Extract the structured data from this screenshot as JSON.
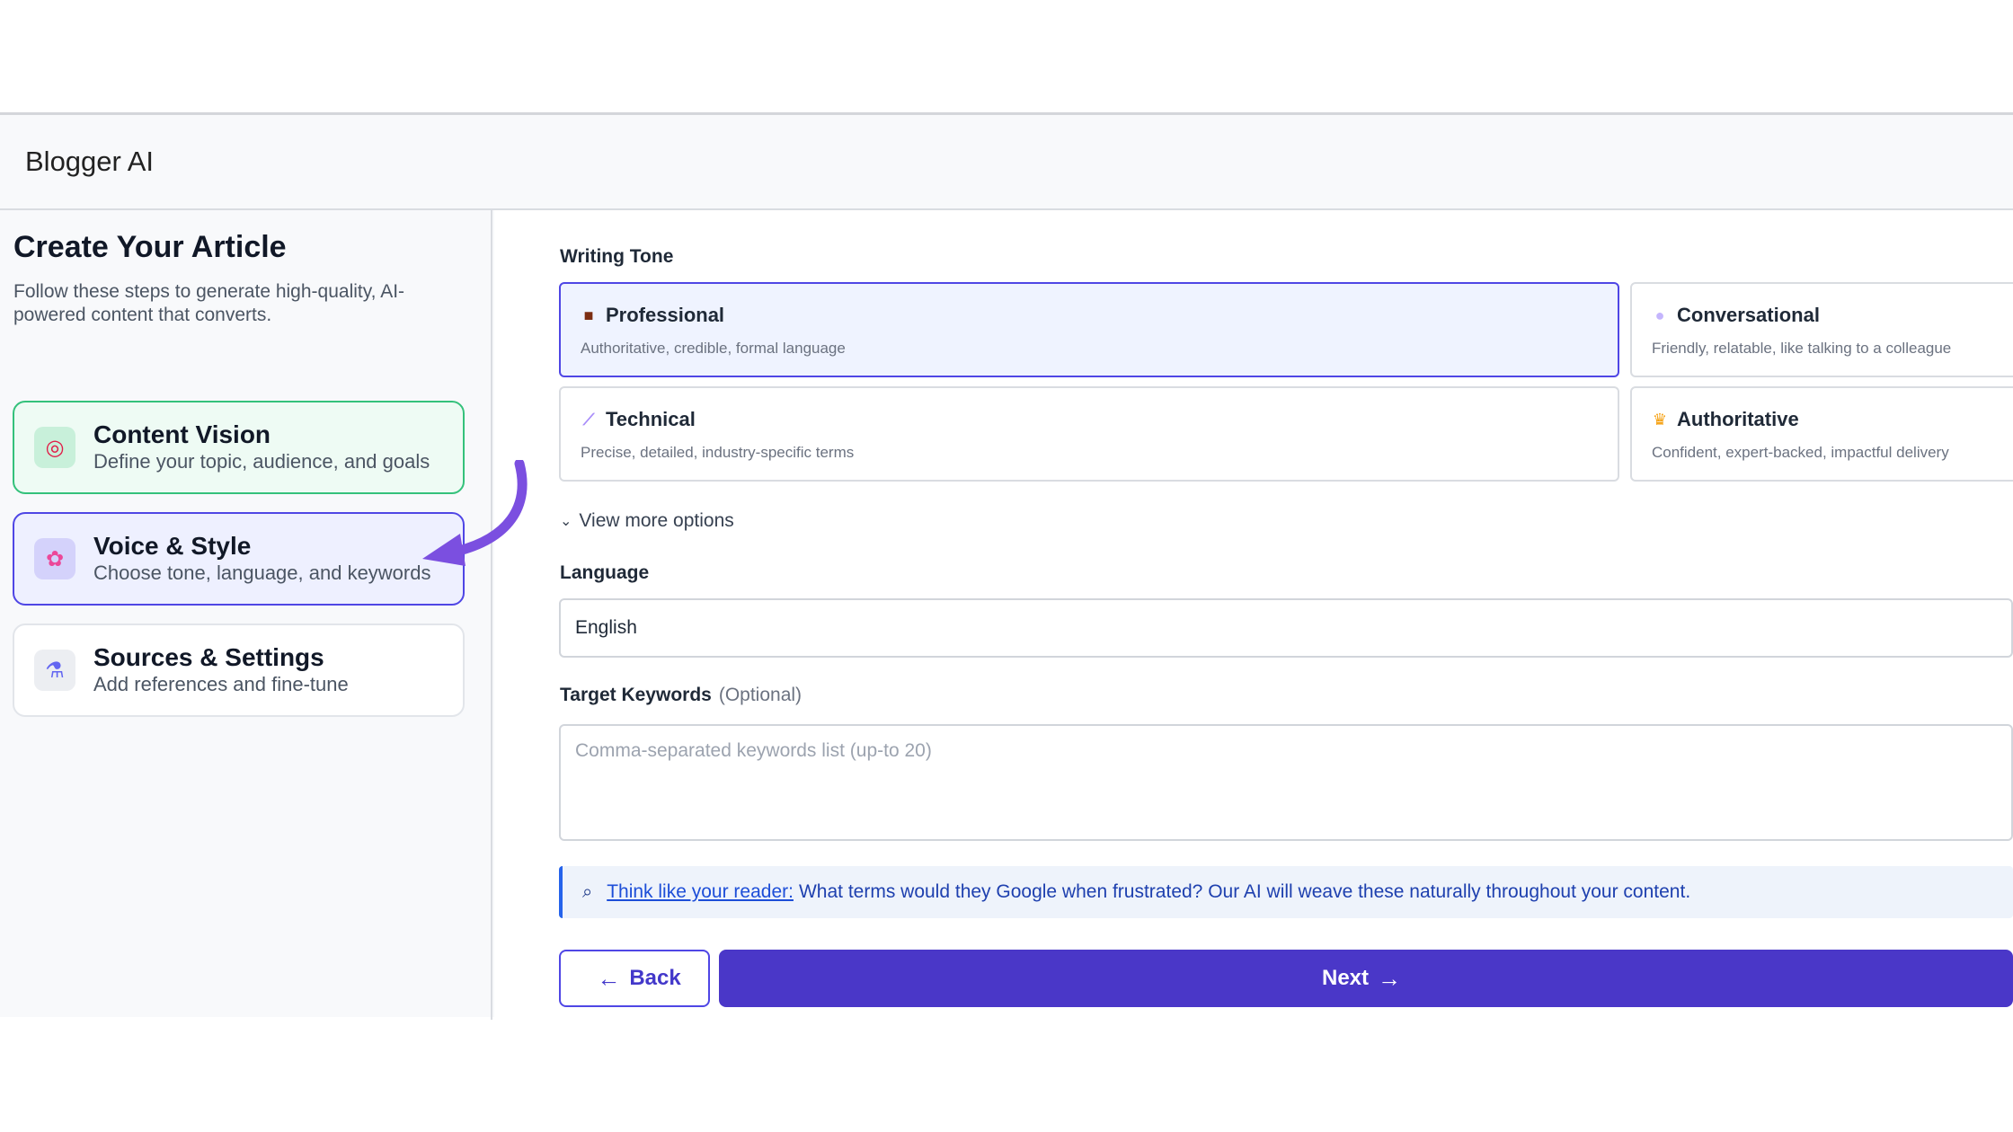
{
  "app": {
    "title": "Blogger AI"
  },
  "sidebar": {
    "heading": "Create Your Article",
    "description": "Follow these steps to generate high-quality, AI-powered content that converts.",
    "steps": [
      {
        "title": "Content Vision",
        "subtitle": "Define your topic, audience, and goals",
        "icon": "target-icon",
        "state": "completed"
      },
      {
        "title": "Voice & Style",
        "subtitle": "Choose tone, language, and keywords",
        "icon": "brain-icon",
        "state": "active"
      },
      {
        "title": "Sources & Settings",
        "subtitle": "Add references and fine-tune",
        "icon": "microscope-icon",
        "state": "pending"
      }
    ]
  },
  "main": {
    "writing_tone_label": "Writing Tone",
    "tones": [
      {
        "title": "Professional",
        "description": "Authoritative, credible, formal language",
        "icon": "top-hat-icon",
        "selected": true
      },
      {
        "title": "Conversational",
        "description": "Friendly, relatable, like talking to a colleague",
        "icon": "speech-bubble-icon",
        "selected": false
      },
      {
        "title": "Technical",
        "description": "Precise, detailed, industry-specific terms",
        "icon": "wrench-icon",
        "selected": false
      },
      {
        "title": "Authoritative",
        "description": "Confident, expert-backed, impactful delivery",
        "icon": "medal-icon",
        "selected": false
      }
    ],
    "view_more": "View more options",
    "language_label": "Language",
    "language_value": "English",
    "keywords_label": "Target Keywords",
    "keywords_optional": "(Optional)",
    "keywords_placeholder": "Comma-separated keywords list (up-to 20)",
    "tip": {
      "icon": "magnifier-icon",
      "link": "Think like your reader:",
      "text": "What terms would they Google when frustrated? Our AI will weave these naturally throughout your content."
    },
    "back_label": "Back",
    "next_label": "Next"
  },
  "colors": {
    "accent": "#4a37c8",
    "completed": "#34c17b",
    "annotation_arrow": "#7b4fe0"
  }
}
